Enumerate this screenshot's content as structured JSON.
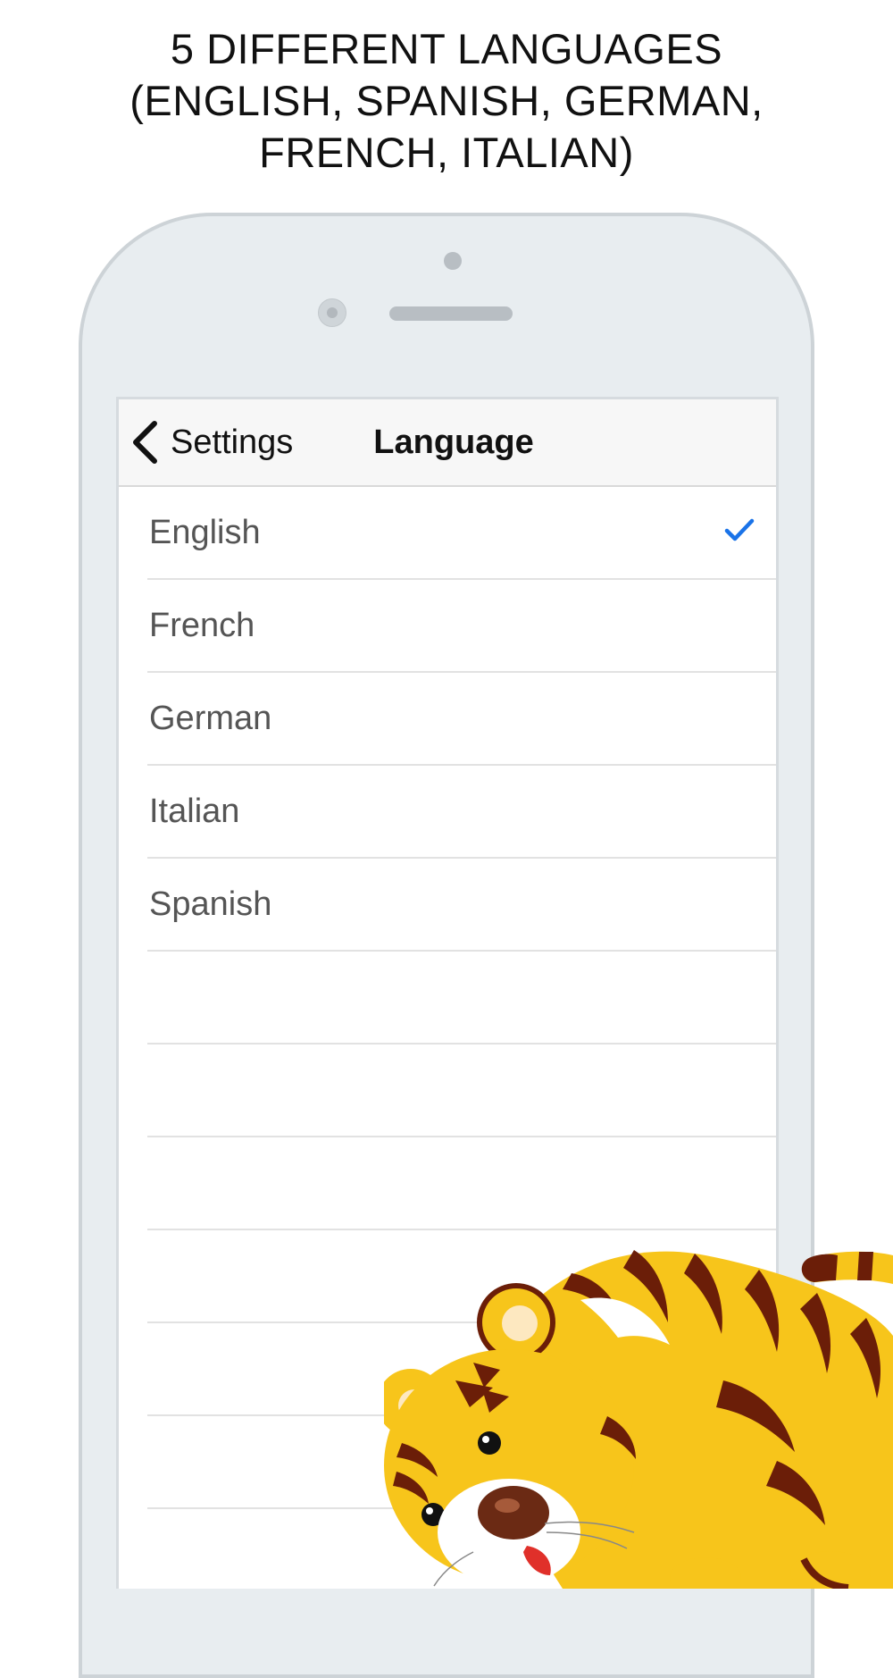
{
  "headline": {
    "lines": [
      "5 DIFFERENT LANGUAGES",
      "(ENGLISH, SPANISH, GERMAN,",
      "FRENCH, ITALIAN)"
    ]
  },
  "navbar": {
    "back_label": "Settings",
    "title": "Language"
  },
  "languages": [
    {
      "label": "English",
      "selected": true
    },
    {
      "label": "French",
      "selected": false
    },
    {
      "label": "German",
      "selected": false
    },
    {
      "label": "Italian",
      "selected": false
    },
    {
      "label": "Spanish",
      "selected": false
    }
  ],
  "icons": {
    "back": "chevron-left-icon",
    "selected": "checkmark-icon"
  },
  "colors": {
    "accent": "#1a73e8",
    "tiger_body": "#f7c51b",
    "tiger_stripes": "#6b1e08"
  }
}
